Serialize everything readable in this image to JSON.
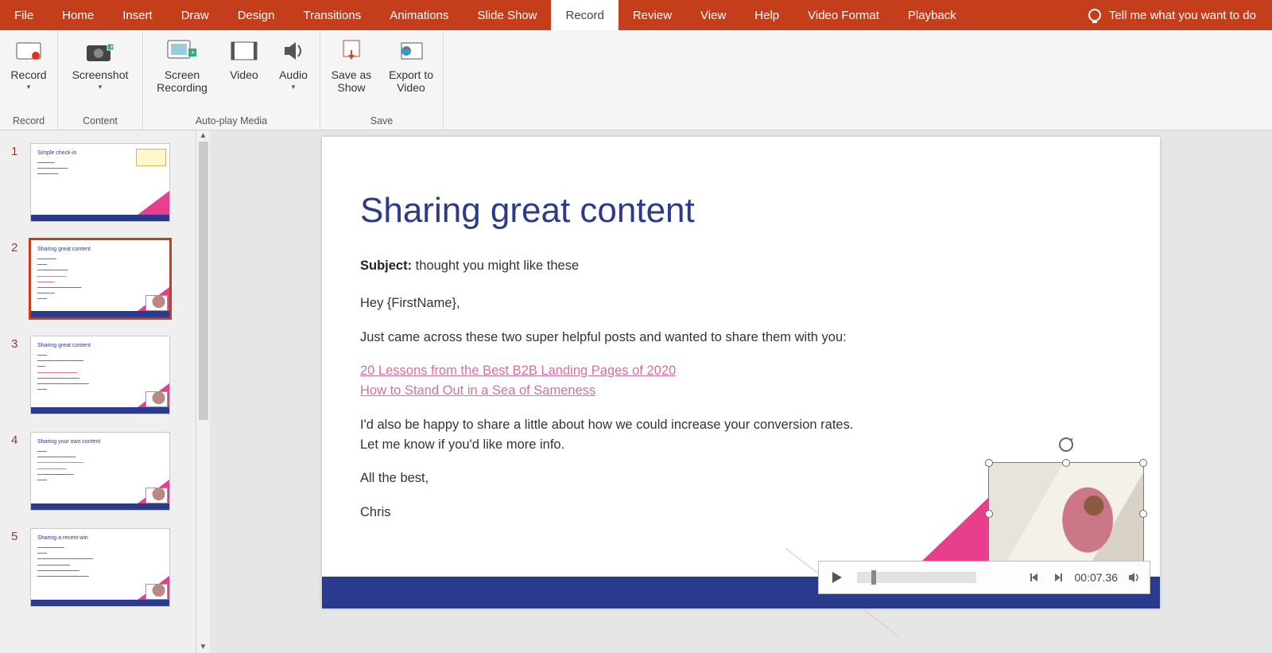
{
  "tabs": {
    "file": "File",
    "home": "Home",
    "insert": "Insert",
    "draw": "Draw",
    "design": "Design",
    "transitions": "Transitions",
    "animations": "Animations",
    "slideshow": "Slide Show",
    "record": "Record",
    "review": "Review",
    "view": "View",
    "help": "Help",
    "video_format": "Video Format",
    "playback": "Playback",
    "tell_me": "Tell me what you want to do"
  },
  "ribbon": {
    "record_group": "Record",
    "content_group": "Content",
    "autoplay_group": "Auto-play Media",
    "save_group": "Save",
    "record_btn": "Record",
    "screenshot": "Screenshot",
    "screen_recording": "Screen Recording",
    "video": "Video",
    "audio": "Audio",
    "save_as_show": "Save as Show",
    "export_to_video": "Export to Video"
  },
  "thumbs": [
    {
      "num": "1",
      "title": "Simple check-in"
    },
    {
      "num": "2",
      "title": "Sharing great content"
    },
    {
      "num": "3",
      "title": "Sharing great content"
    },
    {
      "num": "4",
      "title": "Sharing your own content"
    },
    {
      "num": "5",
      "title": "Sharing a recent win"
    }
  ],
  "slide": {
    "title": "Sharing great content",
    "subject_label": "Subject:",
    "subject_value": " thought you might like these",
    "greeting": "Hey {FirstName},",
    "intro": "Just came across these two super helpful posts and wanted to share them with you:",
    "link1": "20 Lessons from the Best B2B Landing Pages of 2020",
    "link2": "How to Stand Out in a Sea of Sameness",
    "pitch": "I'd also be happy to share a little about how we could increase your conversion rates. Let me know if you'd like more info.",
    "signoff": "All the best,",
    "name": "Chris"
  },
  "playback": {
    "time": "00:07.36"
  }
}
